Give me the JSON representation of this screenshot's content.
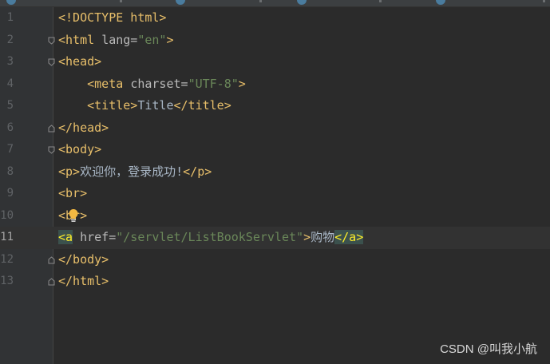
{
  "editor": {
    "current_line": 11,
    "lines": [
      {
        "num": "1",
        "tokens": [
          {
            "t": "tag",
            "v": "<!DOCTYPE html>"
          }
        ]
      },
      {
        "num": "2",
        "tokens": [
          {
            "t": "tag",
            "v": "<html "
          },
          {
            "t": "attr",
            "v": "lang="
          },
          {
            "t": "str",
            "v": "\"en\""
          },
          {
            "t": "tag",
            "v": ">"
          }
        ]
      },
      {
        "num": "3",
        "tokens": [
          {
            "t": "tag",
            "v": "<head>"
          }
        ]
      },
      {
        "num": "4",
        "tokens": [
          {
            "t": "txt",
            "v": "    "
          },
          {
            "t": "tag",
            "v": "<meta "
          },
          {
            "t": "attr",
            "v": "charset="
          },
          {
            "t": "str",
            "v": "\"UTF-8\""
          },
          {
            "t": "tag",
            "v": ">"
          }
        ]
      },
      {
        "num": "5",
        "tokens": [
          {
            "t": "txt",
            "v": "    "
          },
          {
            "t": "tag",
            "v": "<title>"
          },
          {
            "t": "txt",
            "v": "Title"
          },
          {
            "t": "tag",
            "v": "</title>"
          }
        ]
      },
      {
        "num": "6",
        "tokens": [
          {
            "t": "tag",
            "v": "</head>"
          }
        ]
      },
      {
        "num": "7",
        "tokens": [
          {
            "t": "tag",
            "v": "<body>"
          }
        ]
      },
      {
        "num": "8",
        "tokens": [
          {
            "t": "tag",
            "v": "<p>"
          },
          {
            "t": "txt",
            "v": "欢迎你，登录成功!"
          },
          {
            "t": "tag",
            "v": "</p>"
          }
        ]
      },
      {
        "num": "9",
        "tokens": [
          {
            "t": "tag",
            "v": "<br>"
          }
        ]
      },
      {
        "num": "10",
        "tokens": [
          {
            "t": "tag",
            "v": "<br>"
          }
        ]
      },
      {
        "num": "11",
        "tokens": [
          {
            "t": "match",
            "v": "<a"
          },
          {
            "t": "attr",
            "v": " href="
          },
          {
            "t": "str",
            "v": "\"/servlet/ListBookServlet\""
          },
          {
            "t": "tag",
            "v": ">"
          },
          {
            "t": "txt",
            "v": "购物"
          },
          {
            "t": "match",
            "v": "</a>"
          }
        ]
      },
      {
        "num": "12",
        "tokens": [
          {
            "t": "tag",
            "v": "</body>"
          }
        ]
      },
      {
        "num": "13",
        "tokens": [
          {
            "t": "tag",
            "v": "</html>"
          }
        ]
      }
    ],
    "fold_lines": [
      2,
      3,
      6,
      7,
      12,
      13
    ],
    "bulb_line": 10
  },
  "watermark": "CSDN @叫我小航",
  "colors": {
    "background": "#2b2b2b",
    "gutter": "#313335",
    "tag": "#e8bf6a",
    "attribute": "#bababa",
    "string": "#6a8759",
    "text": "#a9b7c6",
    "brace_match_bg": "#3b514d",
    "brace_match_fg": "#ffef28"
  },
  "icons": {
    "fold": "fold-marker-icon",
    "intention": "lightbulb-icon"
  }
}
